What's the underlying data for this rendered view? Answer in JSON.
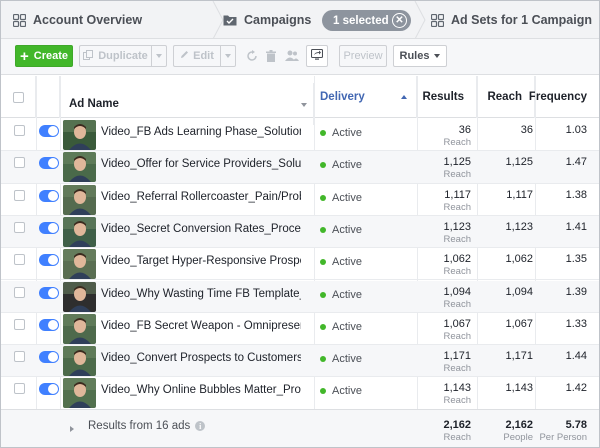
{
  "tabs": {
    "account": "Account Overview",
    "campaigns": "Campaigns",
    "selected": "1 selected",
    "adsets": "Ad Sets for 1 Campaign"
  },
  "toolbar": {
    "create": "Create",
    "duplicate": "Duplicate",
    "edit": "Edit",
    "preview": "Preview",
    "rules": "Rules"
  },
  "columns": {
    "ad_name": "Ad Name",
    "delivery": "Delivery",
    "results": "Results",
    "reach": "Reach",
    "frequency": "Frequency"
  },
  "rows": [
    {
      "name": "Video_FB Ads Learning Phase_Solution/application/Quiz",
      "delivery": "Active",
      "results": "36",
      "results_sub": "Reach",
      "reach": "36",
      "frequency": "1.03"
    },
    {
      "name": "Video_Offer for Service Providers_Solution/Application",
      "delivery": "Active",
      "results": "1,125",
      "results_sub": "Reach",
      "reach": "1,125",
      "frequency": "1.47"
    },
    {
      "name": "Video_Referral Rollercoaster_Pain/Problem_Ad",
      "delivery": "Active",
      "results": "1,117",
      "results_sub": "Reach",
      "reach": "1,117",
      "frequency": "1.38"
    },
    {
      "name": "Video_Secret Conversion Rates_Process/Method_Ad",
      "delivery": "Active",
      "results": "1,123",
      "results_sub": "Reach",
      "reach": "1,123",
      "frequency": "1.41"
    },
    {
      "name": "Video_Target Hyper-Responsive Prospects_Process",
      "delivery": "Active",
      "results": "1,062",
      "results_sub": "Reach",
      "reach": "1,062",
      "frequency": "1.35"
    },
    {
      "name": "Video_Why Wasting Time FB Template_Pain/Problem",
      "delivery": "Active",
      "results": "1,094",
      "results_sub": "Reach",
      "reach": "1,094",
      "frequency": "1.39"
    },
    {
      "name": "Video_FB Secret Weapon - Omnipresence_Process",
      "delivery": "Active",
      "results": "1,067",
      "results_sub": "Reach",
      "reach": "1,067",
      "frequency": "1.33"
    },
    {
      "name": "Video_Convert Prospects to Customers_Solution/App",
      "delivery": "Active",
      "results": "1,171",
      "results_sub": "Reach",
      "reach": "1,171",
      "frequency": "1.44"
    },
    {
      "name": "Video_Why Online Bubbles Matter_Process/Method_Ad",
      "delivery": "Active",
      "results": "1,143",
      "results_sub": "Reach",
      "reach": "1,143",
      "frequency": "1.42"
    }
  ],
  "footer": {
    "label": "Results from 16 ads",
    "results": "2,162",
    "results_sub": "Reach",
    "reach": "2,162",
    "reach_sub": "People",
    "frequency": "5.78",
    "frequency_sub": "Per Person"
  },
  "colors": {
    "accent": "#4267b2",
    "create": "#42b72a",
    "toggle": "#4080ff",
    "active_dot": "#42b72a"
  }
}
